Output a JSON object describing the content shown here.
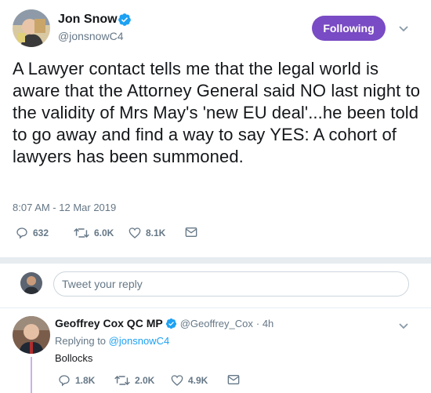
{
  "tweet": {
    "author_name": "Jon Snow",
    "author_handle": "@jonsnowC4",
    "follow_label": "Following",
    "text": "A Lawyer contact tells me that the legal world is aware that the Attorney General said NO last night to the validity of Mrs May's 'new EU deal'...he been told to go away and find a way to say YES: A cohort of lawyers has been summoned.",
    "timestamp": "8:07 AM - 12 Mar 2019",
    "replies": "632",
    "retweets": "6.0K",
    "likes": "8.1K"
  },
  "reply_input": {
    "placeholder": "Tweet your reply"
  },
  "reply": {
    "author_name": "Geoffrey Cox QC MP",
    "author_handle": "@Geoffrey_Cox",
    "time": "· 4h",
    "replying_prefix": "Replying to",
    "replying_to": "@jonsnowC4",
    "text": "Bollocks",
    "replies": "1.8K",
    "retweets": "2.0K",
    "likes": "4.9K"
  },
  "colors": {
    "follow_button": "#794bc4",
    "verified": "#1da1f2",
    "link": "#1da1f2",
    "thread_line": "#c7b3e6"
  }
}
